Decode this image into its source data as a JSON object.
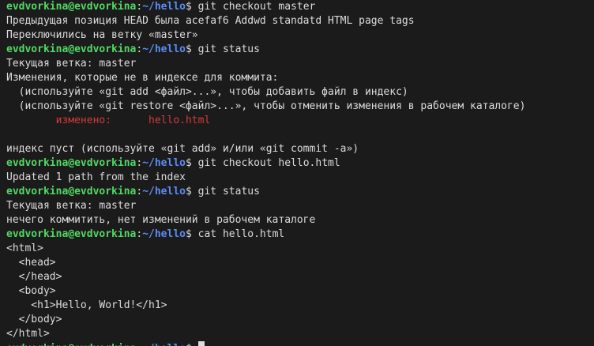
{
  "prompt": {
    "user": "evdvorkina@evdvorkina",
    "colon": ":",
    "path": "~/hello",
    "dollar": "$"
  },
  "lines": [
    {
      "type": "cmd",
      "command": " git checkout master"
    },
    {
      "type": "out",
      "text": "Предыдущая позиция HEAD была acefaf6 Addwd standatd HTML page tags"
    },
    {
      "type": "out",
      "text": "Переключились на ветку «master»"
    },
    {
      "type": "cmd",
      "command": " git status"
    },
    {
      "type": "out",
      "text": "Текущая ветка: master"
    },
    {
      "type": "out",
      "text": "Изменения, которые не в индексе для коммита:"
    },
    {
      "type": "out",
      "text": "  (используйте «git add <файл>...», чтобы добавить файл в индекс)"
    },
    {
      "type": "out",
      "text": "  (используйте «git restore <файл>...», чтобы отменить изменения в рабочем каталоге)"
    },
    {
      "type": "red",
      "text": "\tизменено:      hello.html"
    },
    {
      "type": "out",
      "text": ""
    },
    {
      "type": "out",
      "text": "индекс пуст (используйте «git add» и/или «git commit -a»)"
    },
    {
      "type": "cmd",
      "command": " git checkout hello.html"
    },
    {
      "type": "out",
      "text": "Updated 1 path from the index"
    },
    {
      "type": "cmd",
      "command": " git status"
    },
    {
      "type": "out",
      "text": "Текущая ветка: master"
    },
    {
      "type": "out",
      "text": "нечего коммитить, нет изменений в рабочем каталоге"
    },
    {
      "type": "cmd",
      "command": " cat hello.html"
    },
    {
      "type": "out",
      "text": "<html>"
    },
    {
      "type": "out",
      "text": "  <head>"
    },
    {
      "type": "out",
      "text": "  </head>"
    },
    {
      "type": "out",
      "text": "  <body>"
    },
    {
      "type": "out",
      "text": "    <h1>Hello, World!</h1>"
    },
    {
      "type": "out",
      "text": "  </body>"
    },
    {
      "type": "out",
      "text": "</html>"
    },
    {
      "type": "prompt",
      "command": " "
    }
  ],
  "colors": {
    "background": "#1b1b1b",
    "prompt_user": "#52d964",
    "prompt_path": "#5b8cf5",
    "modified": "#d43a3a",
    "text": "#dcdcdc"
  }
}
